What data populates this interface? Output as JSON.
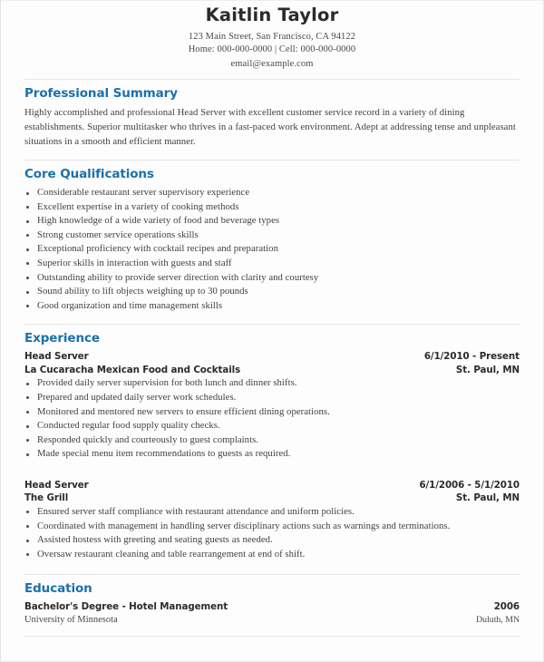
{
  "header": {
    "name": "Kaitlin Taylor",
    "address": "123 Main Street, San Francisco, CA 94122",
    "phones": "Home: 000-000-0000 | Cell: 000-000-0000",
    "email": "email@example.com"
  },
  "theme": {
    "heading_color": "#1a70ad",
    "text_color": "#3f3f3f",
    "name_color": "#2b2b2b",
    "rule_color": "#e6e6e6"
  },
  "summary": {
    "title": "Professional Summary",
    "text": "Highly accomplished and professional Head Server with excellent customer service record in a variety of dining establishments. Superior multitasker who thrives in a fast-paced work environment. Adept at addressing tense and unpleasant situations in a smooth and efficient manner."
  },
  "qualifications": {
    "title": "Core Qualifications",
    "items": [
      "Considerable restaurant server supervisory experience",
      "Excellent expertise in a variety of cooking methods",
      "High knowledge of a wide variety of food and beverage types",
      "Strong customer service operations skills",
      "Exceptional proficiency with cocktail recipes and preparation",
      "Superior skills in interaction with guests and staff",
      "Outstanding ability to provide server direction with clarity and courtesy",
      "Sound ability to lift objects weighing up to 30 pounds",
      "Good organization and time management skills"
    ]
  },
  "experience": {
    "title": "Experience",
    "jobs": [
      {
        "title": "Head Server",
        "company": "La Cucaracha Mexican Food and Cocktails",
        "dates": "6/1/2010 - Present",
        "location": "St. Paul, MN",
        "bullets": [
          "Provided daily server supervision for both lunch and dinner shifts.",
          "Prepared and updated daily server work schedules.",
          "Monitored and mentored new servers to ensure efficient dining operations.",
          "Conducted regular food supply quality checks.",
          "Responded quickly and courteously to guest complaints.",
          "Made special menu item recommendations to guests as required."
        ]
      },
      {
        "title": "Head Server",
        "company": "The Grill",
        "dates": "6/1/2006 - 5/1/2010",
        "location": "St. Paul, MN",
        "bullets": [
          "Ensured server staff compliance with restaurant attendance and uniform policies.",
          "Coordinated with management in handling server disciplinary actions such as warnings and terminations.",
          "Assisted hostess with greeting and seating guests as needed.",
          "Oversaw restaurant cleaning and table rearrangement at end of shift."
        ]
      }
    ]
  },
  "education": {
    "title": "Education",
    "degree": "Bachelor's Degree - Hotel Management",
    "year": "2006",
    "school": "University of Minnesota",
    "location": "Duluth, MN"
  }
}
